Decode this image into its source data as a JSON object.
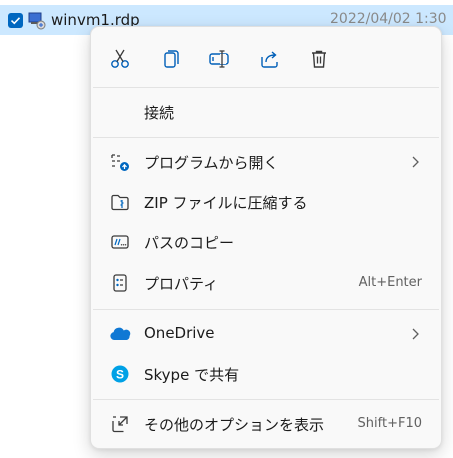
{
  "file": {
    "name": "winvm1.rdp",
    "date": "2022/04/02 1:30"
  },
  "menu": {
    "quick_actions": [
      {
        "name": "cut",
        "icon": "scissors-icon"
      },
      {
        "name": "copy",
        "icon": "copy-icon"
      },
      {
        "name": "rename",
        "icon": "rename-icon"
      },
      {
        "name": "share",
        "icon": "share-icon"
      },
      {
        "name": "delete",
        "icon": "trash-icon"
      }
    ],
    "items": [
      {
        "label": "接続",
        "icon": ""
      },
      {
        "label": "プログラムから開く",
        "icon": "open-with-icon",
        "submenu": true
      },
      {
        "label": "ZIP ファイルに圧縮する",
        "icon": "zip-folder-icon"
      },
      {
        "label": "パスのコピー",
        "icon": "copy-path-icon"
      },
      {
        "label": "プロパティ",
        "icon": "properties-icon",
        "shortcut": "Alt+Enter"
      },
      {
        "label": "OneDrive",
        "icon": "onedrive-icon",
        "submenu": true
      },
      {
        "label": "Skype で共有",
        "icon": "skype-icon"
      },
      {
        "label": "その他のオプションを表示",
        "icon": "more-options-icon",
        "shortcut": "Shift+F10"
      }
    ]
  },
  "colors": {
    "accent": "#0067c0",
    "selection": "#cce8ff",
    "menu_bg": "#f9f9f9",
    "onedrive": "#0f78d4",
    "skype": "#00a1e6"
  }
}
